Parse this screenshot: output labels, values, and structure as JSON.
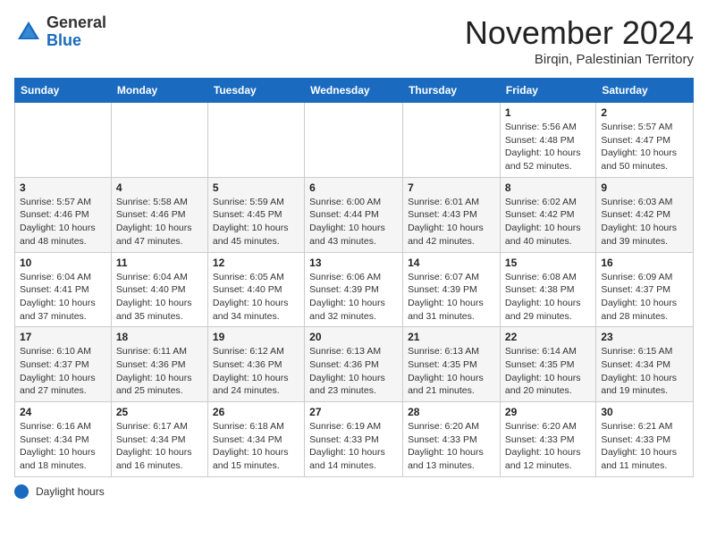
{
  "header": {
    "logo_general": "General",
    "logo_blue": "Blue",
    "month_title": "November 2024",
    "location": "Birqin, Palestinian Territory"
  },
  "calendar": {
    "weekdays": [
      "Sunday",
      "Monday",
      "Tuesday",
      "Wednesday",
      "Thursday",
      "Friday",
      "Saturday"
    ],
    "weeks": [
      [
        {
          "day": "",
          "info": ""
        },
        {
          "day": "",
          "info": ""
        },
        {
          "day": "",
          "info": ""
        },
        {
          "day": "",
          "info": ""
        },
        {
          "day": "",
          "info": ""
        },
        {
          "day": "1",
          "info": "Sunrise: 5:56 AM\nSunset: 4:48 PM\nDaylight: 10 hours and 52 minutes."
        },
        {
          "day": "2",
          "info": "Sunrise: 5:57 AM\nSunset: 4:47 PM\nDaylight: 10 hours and 50 minutes."
        }
      ],
      [
        {
          "day": "3",
          "info": "Sunrise: 5:57 AM\nSunset: 4:46 PM\nDaylight: 10 hours and 48 minutes."
        },
        {
          "day": "4",
          "info": "Sunrise: 5:58 AM\nSunset: 4:46 PM\nDaylight: 10 hours and 47 minutes."
        },
        {
          "day": "5",
          "info": "Sunrise: 5:59 AM\nSunset: 4:45 PM\nDaylight: 10 hours and 45 minutes."
        },
        {
          "day": "6",
          "info": "Sunrise: 6:00 AM\nSunset: 4:44 PM\nDaylight: 10 hours and 43 minutes."
        },
        {
          "day": "7",
          "info": "Sunrise: 6:01 AM\nSunset: 4:43 PM\nDaylight: 10 hours and 42 minutes."
        },
        {
          "day": "8",
          "info": "Sunrise: 6:02 AM\nSunset: 4:42 PM\nDaylight: 10 hours and 40 minutes."
        },
        {
          "day": "9",
          "info": "Sunrise: 6:03 AM\nSunset: 4:42 PM\nDaylight: 10 hours and 39 minutes."
        }
      ],
      [
        {
          "day": "10",
          "info": "Sunrise: 6:04 AM\nSunset: 4:41 PM\nDaylight: 10 hours and 37 minutes."
        },
        {
          "day": "11",
          "info": "Sunrise: 6:04 AM\nSunset: 4:40 PM\nDaylight: 10 hours and 35 minutes."
        },
        {
          "day": "12",
          "info": "Sunrise: 6:05 AM\nSunset: 4:40 PM\nDaylight: 10 hours and 34 minutes."
        },
        {
          "day": "13",
          "info": "Sunrise: 6:06 AM\nSunset: 4:39 PM\nDaylight: 10 hours and 32 minutes."
        },
        {
          "day": "14",
          "info": "Sunrise: 6:07 AM\nSunset: 4:39 PM\nDaylight: 10 hours and 31 minutes."
        },
        {
          "day": "15",
          "info": "Sunrise: 6:08 AM\nSunset: 4:38 PM\nDaylight: 10 hours and 29 minutes."
        },
        {
          "day": "16",
          "info": "Sunrise: 6:09 AM\nSunset: 4:37 PM\nDaylight: 10 hours and 28 minutes."
        }
      ],
      [
        {
          "day": "17",
          "info": "Sunrise: 6:10 AM\nSunset: 4:37 PM\nDaylight: 10 hours and 27 minutes."
        },
        {
          "day": "18",
          "info": "Sunrise: 6:11 AM\nSunset: 4:36 PM\nDaylight: 10 hours and 25 minutes."
        },
        {
          "day": "19",
          "info": "Sunrise: 6:12 AM\nSunset: 4:36 PM\nDaylight: 10 hours and 24 minutes."
        },
        {
          "day": "20",
          "info": "Sunrise: 6:13 AM\nSunset: 4:36 PM\nDaylight: 10 hours and 23 minutes."
        },
        {
          "day": "21",
          "info": "Sunrise: 6:13 AM\nSunset: 4:35 PM\nDaylight: 10 hours and 21 minutes."
        },
        {
          "day": "22",
          "info": "Sunrise: 6:14 AM\nSunset: 4:35 PM\nDaylight: 10 hours and 20 minutes."
        },
        {
          "day": "23",
          "info": "Sunrise: 6:15 AM\nSunset: 4:34 PM\nDaylight: 10 hours and 19 minutes."
        }
      ],
      [
        {
          "day": "24",
          "info": "Sunrise: 6:16 AM\nSunset: 4:34 PM\nDaylight: 10 hours and 18 minutes."
        },
        {
          "day": "25",
          "info": "Sunrise: 6:17 AM\nSunset: 4:34 PM\nDaylight: 10 hours and 16 minutes."
        },
        {
          "day": "26",
          "info": "Sunrise: 6:18 AM\nSunset: 4:34 PM\nDaylight: 10 hours and 15 minutes."
        },
        {
          "day": "27",
          "info": "Sunrise: 6:19 AM\nSunset: 4:33 PM\nDaylight: 10 hours and 14 minutes."
        },
        {
          "day": "28",
          "info": "Sunrise: 6:20 AM\nSunset: 4:33 PM\nDaylight: 10 hours and 13 minutes."
        },
        {
          "day": "29",
          "info": "Sunrise: 6:20 AM\nSunset: 4:33 PM\nDaylight: 10 hours and 12 minutes."
        },
        {
          "day": "30",
          "info": "Sunrise: 6:21 AM\nSunset: 4:33 PM\nDaylight: 10 hours and 11 minutes."
        }
      ]
    ]
  },
  "legend": {
    "daylight_label": "Daylight hours"
  }
}
